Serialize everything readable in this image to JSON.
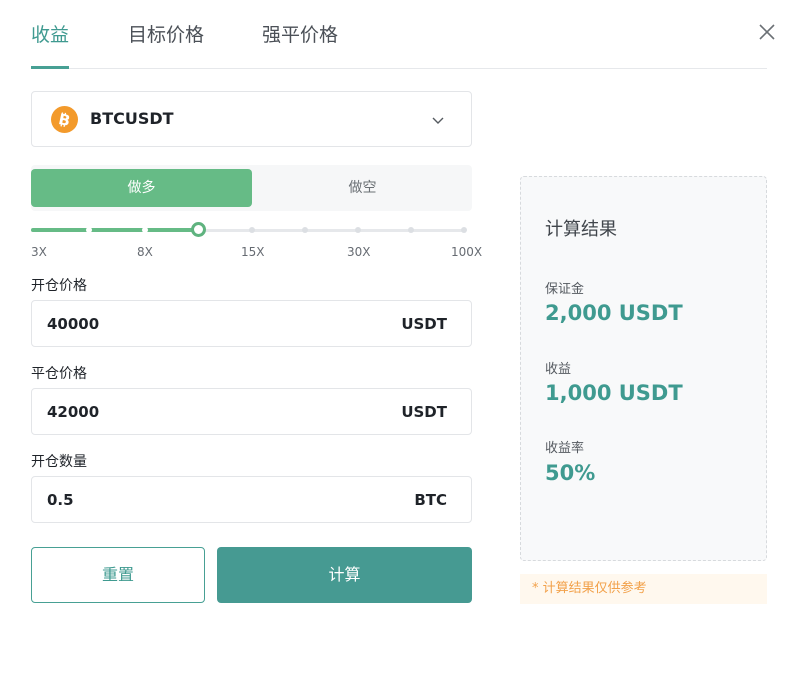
{
  "tabs": [
    {
      "label": "收益",
      "active": true
    },
    {
      "label": "目标价格",
      "active": false
    },
    {
      "label": "强平价格",
      "active": false
    }
  ],
  "close_icon": "close-icon",
  "pair": {
    "symbol": "BTCUSDT",
    "icon": "bitcoin-icon",
    "chevron_icon": "chevron-down-icon"
  },
  "side": {
    "long_label": "做多",
    "short_label": "做空",
    "selected": "long"
  },
  "leverage": {
    "labels": [
      "3X",
      "8X",
      "15X",
      "30X",
      "100X"
    ],
    "selected_fraction": 0.38
  },
  "fields": [
    {
      "label": "开仓价格",
      "value": "40000",
      "unit": "USDT"
    },
    {
      "label": "平仓价格",
      "value": "42000",
      "unit": "USDT"
    },
    {
      "label": "开仓数量",
      "value": "0.5",
      "unit": "BTC"
    }
  ],
  "buttons": {
    "reset": "重置",
    "calculate": "计算"
  },
  "result": {
    "title": "计算结果",
    "margin_label": "保证金",
    "margin_value": "2,000 USDT",
    "pnl_label": "收益",
    "pnl_value": "1,000 USDT",
    "roe_label": "收益率",
    "roe_value": "50%"
  },
  "note": "* 计算结果仅供参考",
  "colors": {
    "accent": "#47a094",
    "long_green": "#66bb86",
    "btc_orange": "#f39a2b",
    "note_orange": "#f2a14a"
  }
}
